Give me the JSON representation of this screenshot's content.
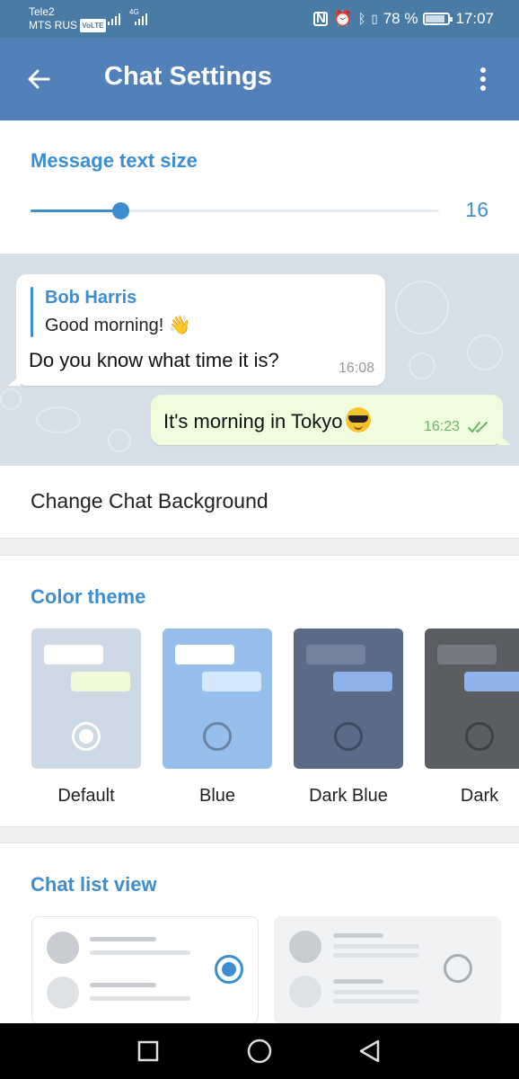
{
  "status_bar": {
    "carrier_1": "Tele2",
    "carrier_2": "MTS RUS",
    "volte": "VoLTE",
    "network": "4G",
    "battery": "78 %",
    "battery_level": 0.78,
    "time": "17:07"
  },
  "app_bar": {
    "title": "Chat Settings",
    "back_icon": "arrow-left-icon",
    "menu_icon": "more-vertical-icon"
  },
  "text_size": {
    "section_title": "Message text size",
    "value": "16",
    "slider_fraction": 0.22
  },
  "preview": {
    "incoming": {
      "reply_name": "Bob Harris",
      "reply_text": "Good morning!",
      "reply_emoji": "👋",
      "text": "Do you know what time it is?",
      "time": "16:08"
    },
    "outgoing": {
      "text": "It's morning in Tokyo",
      "emoji": "smiling-face-with-sunglasses",
      "time": "16:23",
      "status": "read"
    }
  },
  "background": {
    "label": "Change Chat Background"
  },
  "color_theme": {
    "section_title": "Color theme",
    "themes": [
      {
        "label": "Default",
        "selected": true,
        "bg": "#cdd9e5",
        "bubble_in": "#ffffff",
        "bubble_out": "#eefcdc"
      },
      {
        "label": "Blue",
        "selected": false,
        "bg": "#97bfeb",
        "bubble_in": "#ffffff",
        "bubble_out": "#d3e7fd"
      },
      {
        "label": "Dark Blue",
        "selected": false,
        "bg": "#5b6b87",
        "bubble_in": "#74839b",
        "bubble_out": "#8fb1ec"
      },
      {
        "label": "Dark",
        "selected": false,
        "bg": "#5a5d62",
        "bubble_in": "#767a80",
        "bubble_out": "#8fb1ec"
      }
    ]
  },
  "chat_list_view": {
    "section_title": "Chat list view",
    "options": [
      {
        "name": "two-line",
        "selected": true
      },
      {
        "name": "three-line",
        "selected": false
      }
    ]
  },
  "colors": {
    "accent": "#3d8ed1",
    "app_bar": "#5181b8",
    "status_bar": "#4a7ba4"
  },
  "nav_bar": {
    "recent_icon": "square-icon",
    "home_icon": "circle-icon",
    "back_icon": "triangle-back-icon"
  }
}
